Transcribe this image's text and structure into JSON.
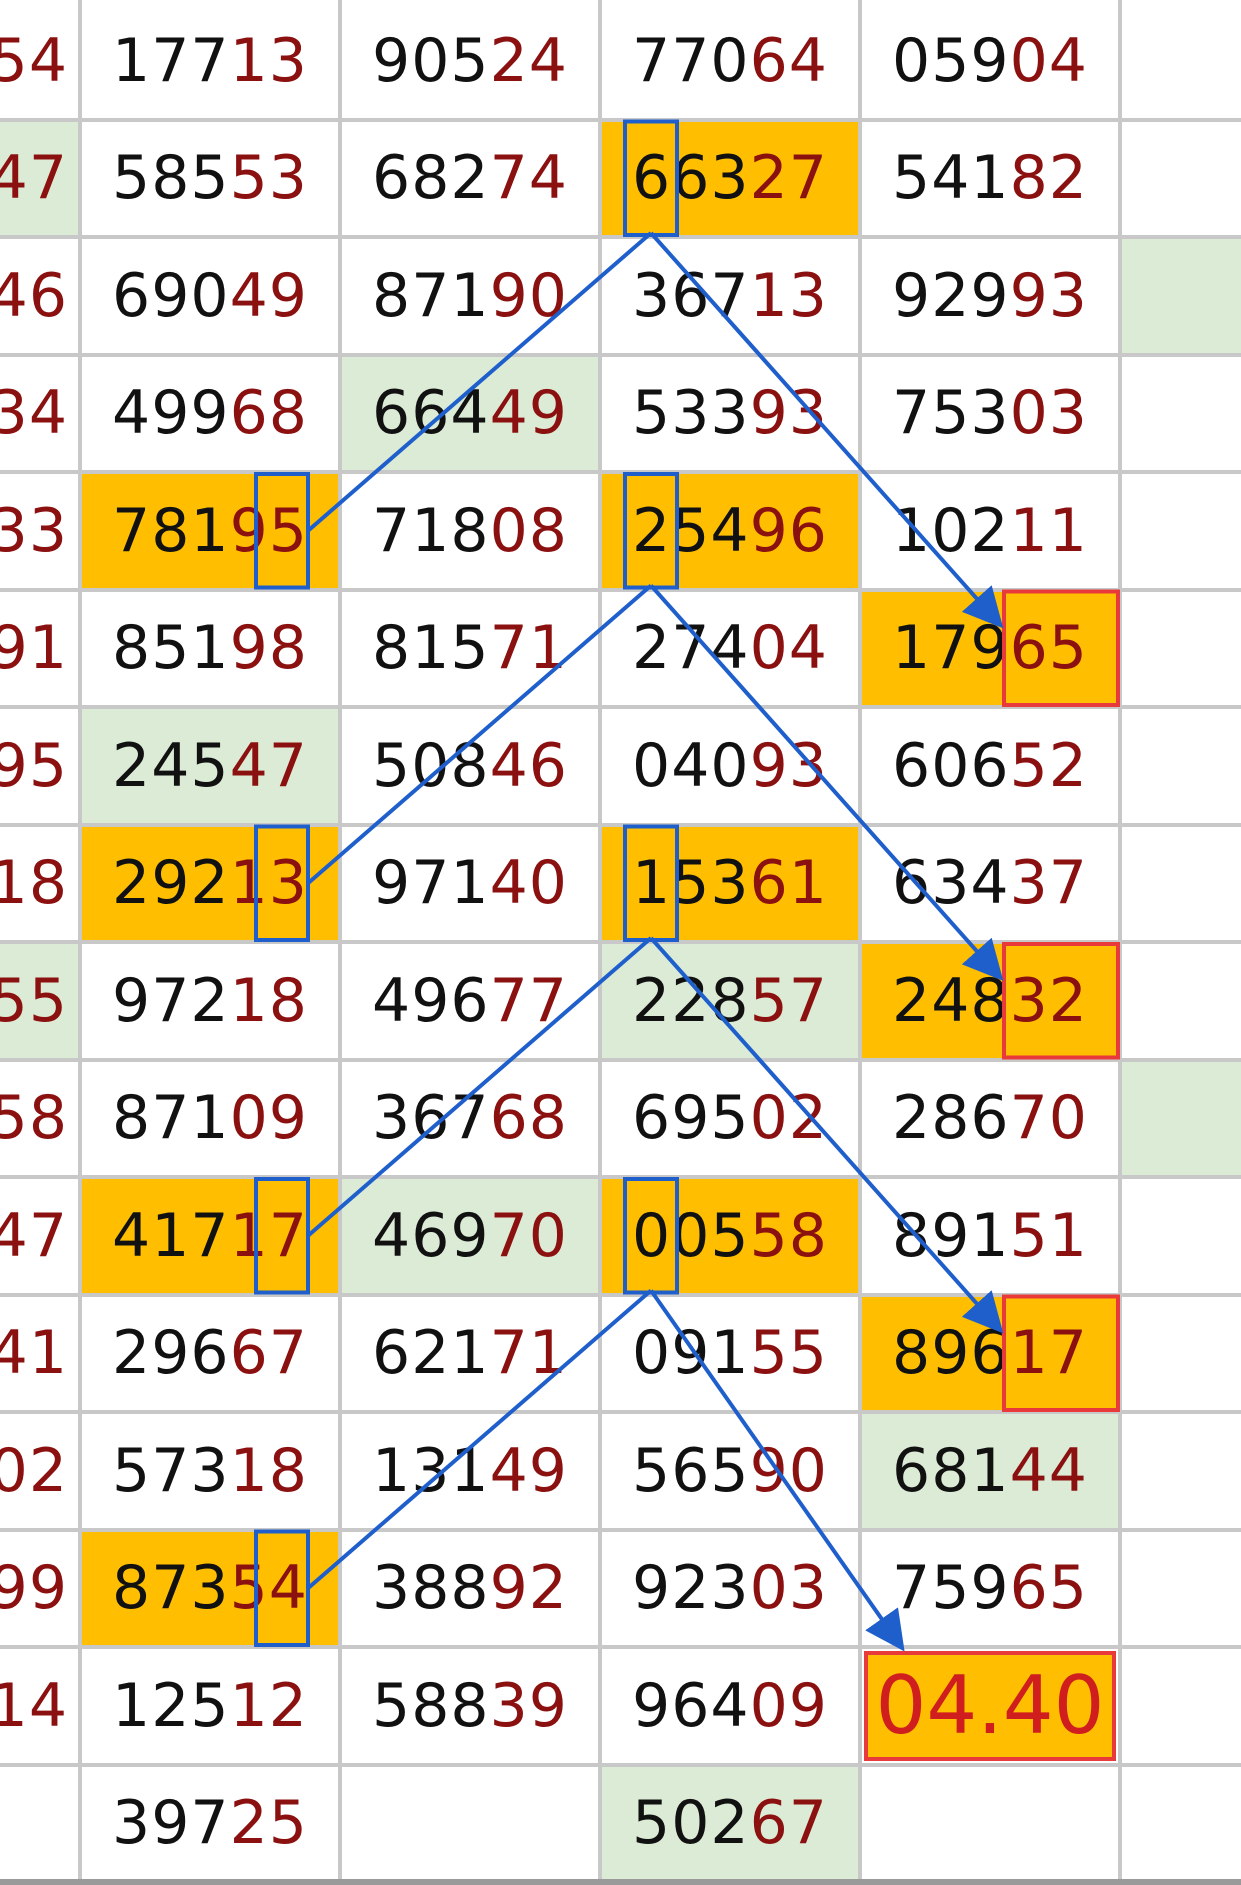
{
  "columns": [
    {
      "key": "c0",
      "partial": true
    },
    {
      "key": "c1"
    },
    {
      "key": "c2"
    },
    {
      "key": "c3"
    },
    {
      "key": "c4"
    },
    {
      "key": "c5"
    }
  ],
  "rows": [
    [
      {
        "a": "",
        "b": "54"
      },
      {
        "a": "177",
        "b": "13"
      },
      {
        "a": "905",
        "b": "24"
      },
      {
        "a": "770",
        "b": "64"
      },
      {
        "a": "059",
        "b": "04"
      },
      {
        "a": "",
        "b": ""
      }
    ],
    [
      {
        "a": "",
        "b": "47",
        "bg": "green"
      },
      {
        "a": "585",
        "b": "53"
      },
      {
        "a": "682",
        "b": "74"
      },
      {
        "a": "663",
        "b": "27",
        "bg": "orange"
      },
      {
        "a": "541",
        "b": "82"
      },
      {
        "a": "",
        "b": ""
      }
    ],
    [
      {
        "a": "",
        "b": "46"
      },
      {
        "a": "690",
        "b": "49"
      },
      {
        "a": "871",
        "b": "90"
      },
      {
        "a": "367",
        "b": "13"
      },
      {
        "a": "929",
        "b": "93"
      },
      {
        "a": "",
        "b": "",
        "bg": "green"
      }
    ],
    [
      {
        "a": "",
        "b": "34"
      },
      {
        "a": "499",
        "b": "68"
      },
      {
        "a": "664",
        "b": "49",
        "bg": "green"
      },
      {
        "a": "533",
        "b": "93"
      },
      {
        "a": "753",
        "b": "03"
      },
      {
        "a": "",
        "b": ""
      }
    ],
    [
      {
        "a": "",
        "b": "33"
      },
      {
        "a": "781",
        "b": "95",
        "bg": "orange"
      },
      {
        "a": "718",
        "b": "08"
      },
      {
        "a": "254",
        "b": "96",
        "bg": "orange"
      },
      {
        "a": "102",
        "b": "11"
      },
      {
        "a": "",
        "b": ""
      }
    ],
    [
      {
        "a": "",
        "b": "91"
      },
      {
        "a": "851",
        "b": "98"
      },
      {
        "a": "815",
        "b": "71"
      },
      {
        "a": "274",
        "b": "04"
      },
      {
        "a": "179",
        "b": "65",
        "bg": "orange"
      },
      {
        "a": "",
        "b": ""
      }
    ],
    [
      {
        "a": "",
        "b": "95"
      },
      {
        "a": "245",
        "b": "47",
        "bg": "green"
      },
      {
        "a": "508",
        "b": "46"
      },
      {
        "a": "040",
        "b": "93"
      },
      {
        "a": "606",
        "b": "52"
      },
      {
        "a": "",
        "b": ""
      }
    ],
    [
      {
        "a": "",
        "b": "18"
      },
      {
        "a": "292",
        "b": "13",
        "bg": "orange"
      },
      {
        "a": "971",
        "b": "40"
      },
      {
        "a": "153",
        "b": "61",
        "bg": "orange"
      },
      {
        "a": "634",
        "b": "37"
      },
      {
        "a": "",
        "b": ""
      }
    ],
    [
      {
        "a": "",
        "b": "55",
        "bg": "green"
      },
      {
        "a": "972",
        "b": "18"
      },
      {
        "a": "496",
        "b": "77"
      },
      {
        "a": "228",
        "b": "57",
        "bg": "green"
      },
      {
        "a": "248",
        "b": "32",
        "bg": "orange"
      },
      {
        "a": "",
        "b": ""
      }
    ],
    [
      {
        "a": "",
        "b": "58"
      },
      {
        "a": "871",
        "b": "09"
      },
      {
        "a": "367",
        "b": "68"
      },
      {
        "a": "695",
        "b": "02"
      },
      {
        "a": "286",
        "b": "70"
      },
      {
        "a": "",
        "b": "",
        "bg": "green"
      }
    ],
    [
      {
        "a": "",
        "b": "47"
      },
      {
        "a": "417",
        "b": "17",
        "bg": "orange"
      },
      {
        "a": "469",
        "b": "70",
        "bg": "green"
      },
      {
        "a": "005",
        "b": "58",
        "bg": "orange"
      },
      {
        "a": "891",
        "b": "51"
      },
      {
        "a": "",
        "b": ""
      }
    ],
    [
      {
        "a": "",
        "b": "41"
      },
      {
        "a": "296",
        "b": "67"
      },
      {
        "a": "621",
        "b": "71"
      },
      {
        "a": "091",
        "b": "55"
      },
      {
        "a": "896",
        "b": "17",
        "bg": "orange"
      },
      {
        "a": "",
        "b": ""
      }
    ],
    [
      {
        "a": "",
        "b": "02"
      },
      {
        "a": "573",
        "b": "18"
      },
      {
        "a": "131",
        "b": "49"
      },
      {
        "a": "565",
        "b": "90"
      },
      {
        "a": "681",
        "b": "44",
        "bg": "green"
      },
      {
        "a": "",
        "b": ""
      }
    ],
    [
      {
        "a": "",
        "b": "99"
      },
      {
        "a": "873",
        "b": "54",
        "bg": "orange"
      },
      {
        "a": "388",
        "b": "92"
      },
      {
        "a": "923",
        "b": "03"
      },
      {
        "a": "759",
        "b": "65"
      },
      {
        "a": "",
        "b": ""
      }
    ],
    [
      {
        "a": "",
        "b": "14"
      },
      {
        "a": "125",
        "b": "12"
      },
      {
        "a": "588",
        "b": "39"
      },
      {
        "a": "964",
        "b": "09"
      },
      {
        "a": "",
        "b": ""
      },
      {
        "a": "",
        "b": ""
      }
    ],
    [
      {
        "a": "",
        "b": ""
      },
      {
        "a": "397",
        "b": "25"
      },
      {
        "a": "",
        "b": ""
      },
      {
        "a": "502",
        "b": "67",
        "bg": "green"
      },
      {
        "a": "",
        "b": ""
      },
      {
        "a": "",
        "b": ""
      }
    ]
  ],
  "result_value": "04.40",
  "blue_boxes": [
    {
      "row": 1,
      "col": 3,
      "digit": 1
    },
    {
      "row": 4,
      "col": 1,
      "digit": 4
    },
    {
      "row": 4,
      "col": 3,
      "digit": 1
    },
    {
      "row": 7,
      "col": 1,
      "digit": 4
    },
    {
      "row": 7,
      "col": 3,
      "digit": 1
    },
    {
      "row": 10,
      "col": 1,
      "digit": 4
    },
    {
      "row": 10,
      "col": 3,
      "digit": 1
    },
    {
      "row": 13,
      "col": 1,
      "digit": 4
    }
  ],
  "red_boxes": [
    {
      "row": 5,
      "col": 4
    },
    {
      "row": 8,
      "col": 4
    },
    {
      "row": 11,
      "col": 4
    }
  ],
  "arrows": [
    {
      "from": [
        4,
        1
      ],
      "to": [
        1,
        3
      ]
    },
    {
      "from": [
        1,
        3
      ],
      "to": [
        5,
        4
      ],
      "head": true
    },
    {
      "from": [
        7,
        1
      ],
      "to": [
        4,
        3
      ]
    },
    {
      "from": [
        4,
        3
      ],
      "to": [
        8,
        4
      ],
      "head": true
    },
    {
      "from": [
        10,
        1
      ],
      "to": [
        7,
        3
      ]
    },
    {
      "from": [
        7,
        3
      ],
      "to": [
        11,
        4
      ],
      "head": true
    },
    {
      "from": [
        13,
        1
      ],
      "to": [
        10,
        3
      ]
    },
    {
      "from": [
        10,
        3
      ],
      "to": [
        14,
        4
      ],
      "head": true
    }
  ],
  "colors": {
    "orange": "#ffbf00",
    "green": "#dcebd6",
    "blue_line": "#1f5fcc",
    "red_box": "#e83a3a",
    "digit_dark": "#111111",
    "digit_red": "#8b1010",
    "grid": "#c8c8c8"
  }
}
